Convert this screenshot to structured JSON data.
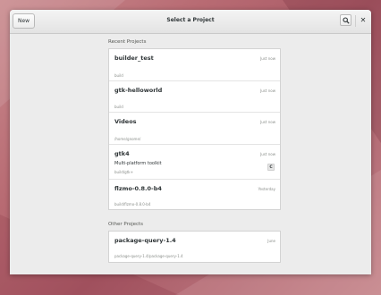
{
  "window": {
    "title": "Select a Project",
    "new_button": "New",
    "search_icon": "search-icon",
    "close_icon": "close-icon"
  },
  "recent": {
    "heading": "Recent Projects",
    "projects": [
      {
        "name": "builder_test",
        "description": "",
        "path": "build",
        "time": "Just now",
        "badge": ""
      },
      {
        "name": "gtk-helloworld",
        "description": "",
        "path": "build",
        "time": "Just now",
        "badge": ""
      },
      {
        "name": "Videos",
        "description": "",
        "path": "/home/gnome/",
        "time": "Just now",
        "badge": ""
      },
      {
        "name": "gtk4",
        "description": "Multi-platform toolkit",
        "path": "build/gtk+",
        "time": "Just now",
        "badge": "C"
      },
      {
        "name": "flzmo-0.8.0-b4",
        "description": "",
        "path": "build/flzmo-0.8.0-b4",
        "time": "Yesterday",
        "badge": ""
      }
    ]
  },
  "other": {
    "heading": "Other Projects",
    "projects": [
      {
        "name": "package-query-1.4",
        "description": "",
        "path": "package-query-1.4/package-query-1.4",
        "time": "June",
        "badge": ""
      }
    ]
  }
}
